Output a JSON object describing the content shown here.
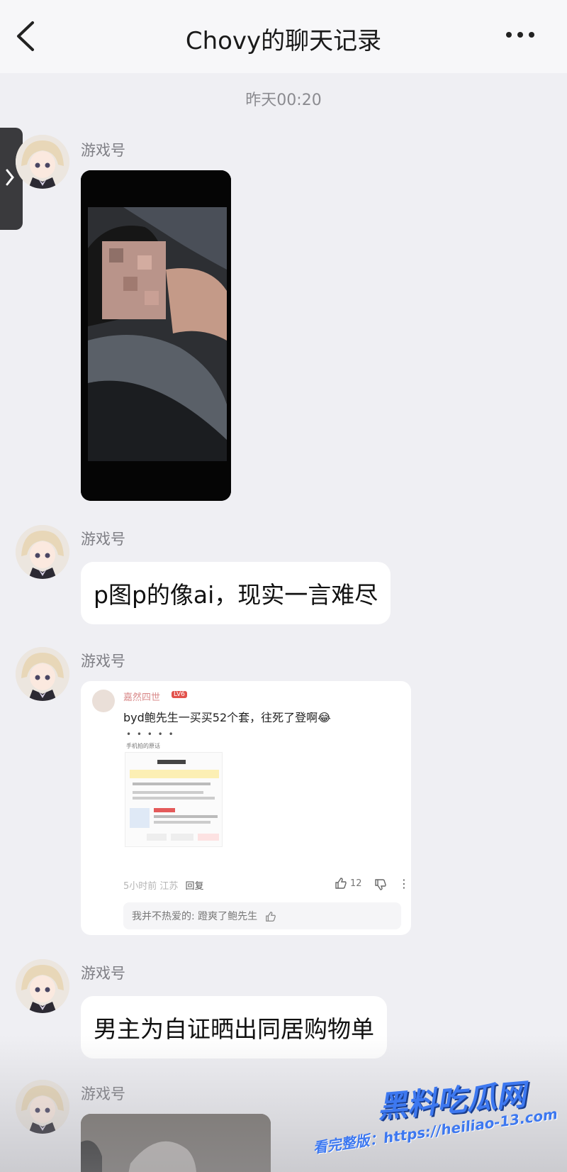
{
  "header": {
    "title": "Chovy的聊天记录",
    "back_icon": "chevron-left-icon",
    "more_icon": "more-dots-icon"
  },
  "timestamp": "昨天00:20",
  "messages": [
    {
      "type": "image",
      "sender": "游戏号"
    },
    {
      "type": "text",
      "sender": "游戏号",
      "text": "p图p的像ai，现实一言难尽"
    },
    {
      "type": "comment-screenshot",
      "sender": "游戏号",
      "comment": {
        "user": "嘉然四世",
        "level": "LV6",
        "text": "byd鲍先生一买买52个套，往死了登啊😂",
        "dots": "• • • • •",
        "sub": "手机拍的原话",
        "time_location": "5小时前 江苏",
        "reply_label": "回复",
        "likes": "12",
        "reply_preview": "我并不热爱的: 蹬爽了鲍先生"
      }
    },
    {
      "type": "text",
      "sender": "游戏号",
      "text": "男主为自证晒出同居购物单"
    },
    {
      "type": "image",
      "sender": "游戏号"
    }
  ],
  "watermark": {
    "logo": "黑料吃瓜网",
    "url": "看完整版：https://heiliao-13.com"
  }
}
